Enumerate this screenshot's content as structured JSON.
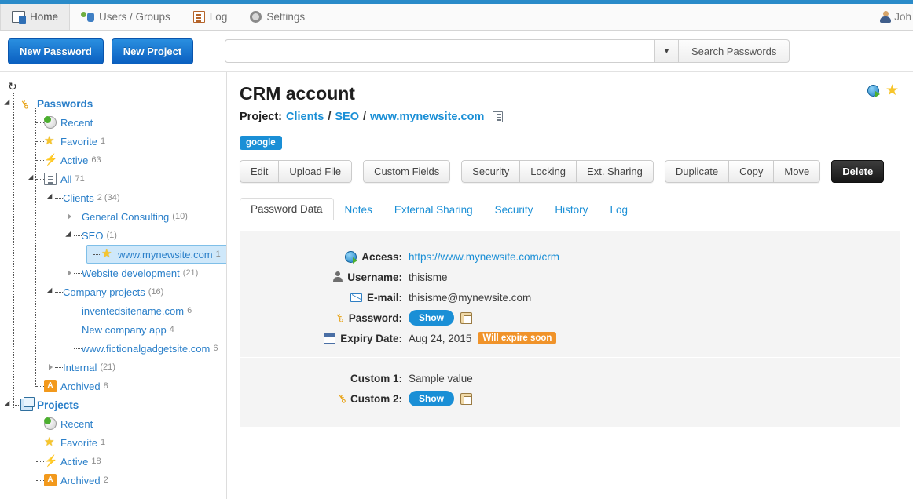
{
  "topnav": {
    "items": [
      {
        "label": "Home",
        "icon": "home-icon",
        "active": true
      },
      {
        "label": "Users / Groups",
        "icon": "users-icon",
        "active": false
      },
      {
        "label": "Log",
        "icon": "log-icon",
        "active": false
      },
      {
        "label": "Settings",
        "icon": "gear-icon",
        "active": false
      }
    ],
    "user": "Joh"
  },
  "toolbar": {
    "new_password_label": "New Password",
    "new_project_label": "New Project",
    "search_value": "",
    "search_placeholder": "",
    "search_button_label": "Search Passwords",
    "caret_glyph": "▼"
  },
  "sidebar": {
    "reload_glyph": "↻",
    "groups": [
      {
        "title": "Passwords",
        "icon": "key-icon",
        "items": [
          {
            "label": "Recent",
            "icon": "recent-clock-icon",
            "count": "",
            "depth": 1
          },
          {
            "label": "Favorite",
            "icon": "star-icon",
            "count": "1",
            "depth": 1
          },
          {
            "label": "Active",
            "icon": "bolt-icon",
            "count": "63",
            "depth": 1
          },
          {
            "label": "All",
            "icon": "list-icon",
            "count": "71",
            "depth": 1,
            "expanded": true
          },
          {
            "label": "Clients",
            "icon": "",
            "count": "2 (34)",
            "depth": 2,
            "expanded": true
          },
          {
            "label": "General Consulting",
            "icon": "",
            "count": "(10)",
            "depth": 3,
            "collapsed": true
          },
          {
            "label": "SEO",
            "icon": "",
            "count": "(1)",
            "depth": 3,
            "expanded": true
          },
          {
            "label": "www.mynewsite.com",
            "icon": "star-icon",
            "count": "1",
            "depth": 4,
            "selected": true
          },
          {
            "label": "Website development",
            "icon": "",
            "count": "(21)",
            "depth": 3,
            "collapsed": true
          },
          {
            "label": "Company projects",
            "icon": "",
            "count": "(16)",
            "depth": 2,
            "expanded": true
          },
          {
            "label": "inventedsitename.com",
            "icon": "",
            "count": "6",
            "depth": 3
          },
          {
            "label": "New company app",
            "icon": "",
            "count": "4",
            "depth": 3
          },
          {
            "label": "www.fictionalgadgetsite.com",
            "icon": "",
            "count": "6",
            "depth": 3
          },
          {
            "label": "Internal",
            "icon": "",
            "count": "(21)",
            "depth": 2,
            "collapsed": true
          },
          {
            "label": "Archived",
            "icon": "archive-icon",
            "count": "8",
            "depth": 1
          }
        ]
      },
      {
        "title": "Projects",
        "icon": "projects-icon",
        "items": [
          {
            "label": "Recent",
            "icon": "recent-clock-icon",
            "count": "",
            "depth": 1
          },
          {
            "label": "Favorite",
            "icon": "star-icon",
            "count": "1",
            "depth": 1
          },
          {
            "label": "Active",
            "icon": "bolt-icon",
            "count": "18",
            "depth": 1
          },
          {
            "label": "Archived",
            "icon": "archive-icon",
            "count": "2",
            "depth": 1
          }
        ]
      }
    ]
  },
  "main": {
    "title": "CRM account",
    "breadcrumb_label": "Project:",
    "breadcrumb": [
      "Clients",
      "SEO",
      "www.mynewsite.com"
    ],
    "breadcrumb_separator": "/",
    "tag": "google",
    "actions": {
      "group1": [
        "Edit",
        "Upload File"
      ],
      "group2": [
        "Custom Fields"
      ],
      "group3": [
        "Security",
        "Locking",
        "Ext. Sharing"
      ],
      "group4": [
        "Duplicate",
        "Copy",
        "Move"
      ],
      "delete": "Delete"
    },
    "tabs": [
      {
        "label": "Password Data",
        "active": true
      },
      {
        "label": "Notes",
        "active": false
      },
      {
        "label": "External Sharing",
        "active": false
      },
      {
        "label": "Security",
        "active": false
      },
      {
        "label": "History",
        "active": false
      },
      {
        "label": "Log",
        "active": false
      }
    ],
    "fields_primary": [
      {
        "icon": "globe-go-icon",
        "label": "Access:",
        "value": "https://www.mynewsite.com/crm",
        "type": "link"
      },
      {
        "icon": "user-icon",
        "label": "Username:",
        "value": "thisisme",
        "type": "text"
      },
      {
        "icon": "mail-icon",
        "label": "E-mail:",
        "value": "thisisme@mynewsite.com",
        "type": "text"
      },
      {
        "icon": "key-icon",
        "label": "Password:",
        "value": "",
        "type": "masked",
        "show_label": "Show"
      },
      {
        "icon": "calendar-icon",
        "label": "Expiry Date:",
        "value": "Aug 24, 2015",
        "type": "date",
        "badge": "Will expire soon"
      }
    ],
    "fields_custom": [
      {
        "icon": "",
        "label": "Custom 1:",
        "value": "Sample value",
        "type": "text"
      },
      {
        "icon": "key-icon",
        "label": "Custom 2:",
        "value": "",
        "type": "masked",
        "show_label": "Show"
      }
    ]
  },
  "colors": {
    "accent": "#2a8bc9",
    "link": "#1a8fd6",
    "warn": "#f0932a",
    "panel": "#f4f4f4",
    "selected": "#cfe8fa"
  }
}
